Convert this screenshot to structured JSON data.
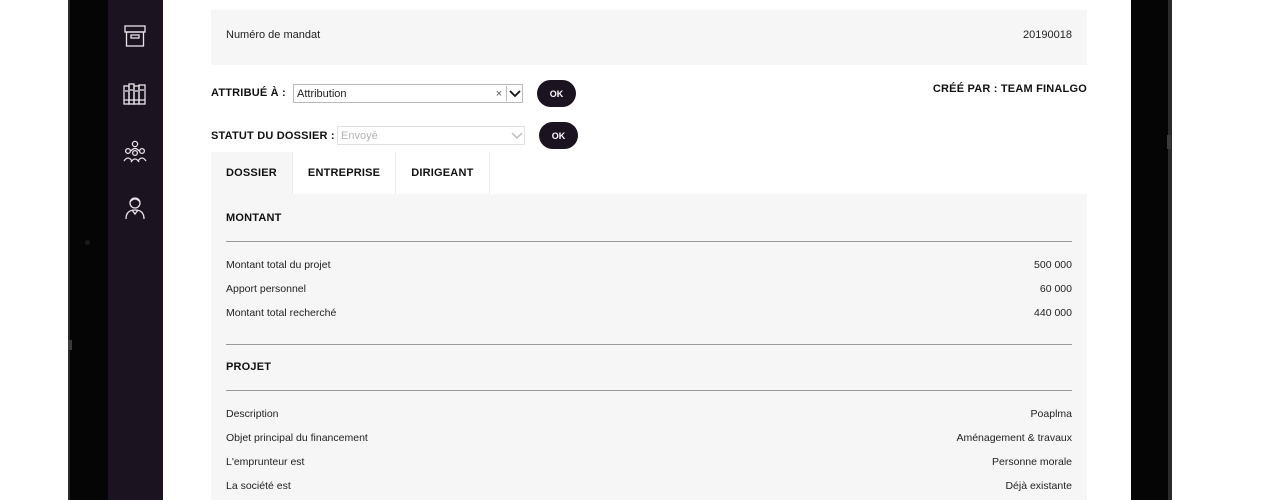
{
  "mandat": {
    "label": "Numéro de mandat",
    "value": "20190018"
  },
  "assignment": {
    "label": "ATTRIBUÉ À :",
    "value": "Attribution",
    "clear": "×",
    "ok": "OK"
  },
  "status": {
    "label": "STATUT DU DOSSIER :",
    "value": "Envoyé",
    "ok": "OK"
  },
  "created_by": "CRÉÉ PAR : TEAM FINALGO",
  "tabs": [
    {
      "label": "DOSSIER",
      "active": true
    },
    {
      "label": "ENTREPRISE",
      "active": false
    },
    {
      "label": "DIRIGEANT",
      "active": false
    }
  ],
  "montant": {
    "title": "MONTANT",
    "rows": [
      {
        "label": "Montant total du projet",
        "value": "500 000"
      },
      {
        "label": "Apport personnel",
        "value": "60 000"
      },
      {
        "label": "Montant total recherché",
        "value": "440 000"
      }
    ]
  },
  "projet": {
    "title": "PROJET",
    "rows": [
      {
        "label": "Description",
        "value": "Poaplma"
      },
      {
        "label": "Objet principal du financement",
        "value": "Aménagement & travaux"
      },
      {
        "label": "L'emprunteur est",
        "value": "Personne morale"
      },
      {
        "label": "La société est",
        "value": "Déjà existante"
      }
    ]
  },
  "sidebar": {
    "items": [
      {
        "icon": "archive-box-icon"
      },
      {
        "icon": "binders-icon"
      },
      {
        "icon": "team-icon"
      },
      {
        "icon": "user-icon"
      }
    ]
  },
  "colors": {
    "sidebar": "#1c1320",
    "button": "#1c1320",
    "panel": "#f6f6f6"
  }
}
